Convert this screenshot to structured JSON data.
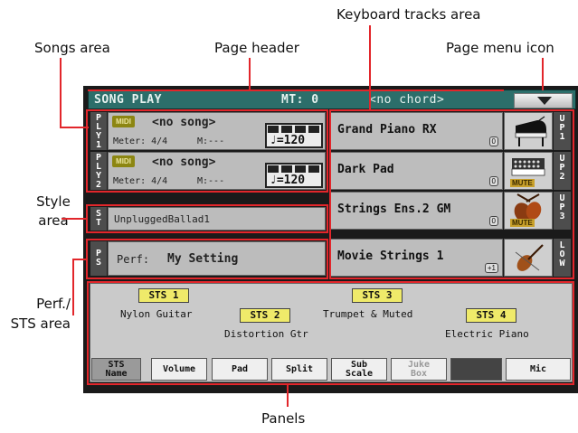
{
  "callouts": {
    "keyboard_tracks_area": "Keyboard tracks area",
    "songs_area": "Songs area",
    "page_header": "Page header",
    "page_menu_icon": "Page menu icon",
    "style_area": "Style\narea",
    "perf_sts_area": "Perf./\nSTS area",
    "panels": "Panels"
  },
  "header": {
    "title": "SONG PLAY",
    "meter_tempo": "MT: 0",
    "chord": "<no chord>"
  },
  "players": [
    {
      "tag": "PLY1",
      "midi": "MIDI",
      "song": "<no song>",
      "meter": "Meter: 4/4",
      "measure": "M:---",
      "tempo": "♩=120"
    },
    {
      "tag": "PLY2",
      "midi": "MIDI",
      "song": "<no song>",
      "meter": "Meter: 4/4",
      "measure": "M:---",
      "tempo": "♩=120"
    }
  ],
  "style": {
    "tag": "ST",
    "name": "UnpluggedBallad1"
  },
  "performance": {
    "tag": "PS",
    "label": "Perf:",
    "name": "My Setting"
  },
  "tracks": [
    {
      "name": "Grand Piano RX",
      "octave": "0",
      "tag": "UP1",
      "icon": "grand-piano-icon",
      "muted": false
    },
    {
      "name": "Dark Pad",
      "octave": "0",
      "tag": "UP2",
      "icon": "synth-keyboard-icon",
      "muted": true
    },
    {
      "name": "Strings Ens.2 GM",
      "octave": "0",
      "tag": "UP3",
      "icon": "strings-section-icon",
      "muted": true
    },
    {
      "name": "Movie Strings 1",
      "octave": "+1",
      "tag": "LOW",
      "icon": "violin-icon",
      "muted": false
    }
  ],
  "mute_label": "MUTE",
  "sts": [
    {
      "button": "STS 1",
      "sound": "Nylon Guitar"
    },
    {
      "button": "STS 2",
      "sound": "Distortion Gtr"
    },
    {
      "button": "STS 3",
      "sound": "Trumpet & Muted"
    },
    {
      "button": "STS 4",
      "sound": "Electric Piano"
    }
  ],
  "tabs": [
    {
      "label": "STS\nName",
      "selected": true,
      "enabled": true
    },
    {
      "label": "Volume",
      "selected": false,
      "enabled": true
    },
    {
      "label": "Pad",
      "selected": false,
      "enabled": true
    },
    {
      "label": "Split",
      "selected": false,
      "enabled": true
    },
    {
      "label": "Sub\nScale",
      "selected": false,
      "enabled": true
    },
    {
      "label": "Juke\nBox",
      "selected": false,
      "enabled": false
    },
    {
      "label": "",
      "selected": false,
      "enabled": false
    },
    {
      "label": "Mic",
      "selected": false,
      "enabled": true
    }
  ],
  "colors": {
    "header": "#2c6e6a",
    "highlight": "#e2262b",
    "sts_button": "#efea6a",
    "midi_badge": "#8c8612"
  }
}
